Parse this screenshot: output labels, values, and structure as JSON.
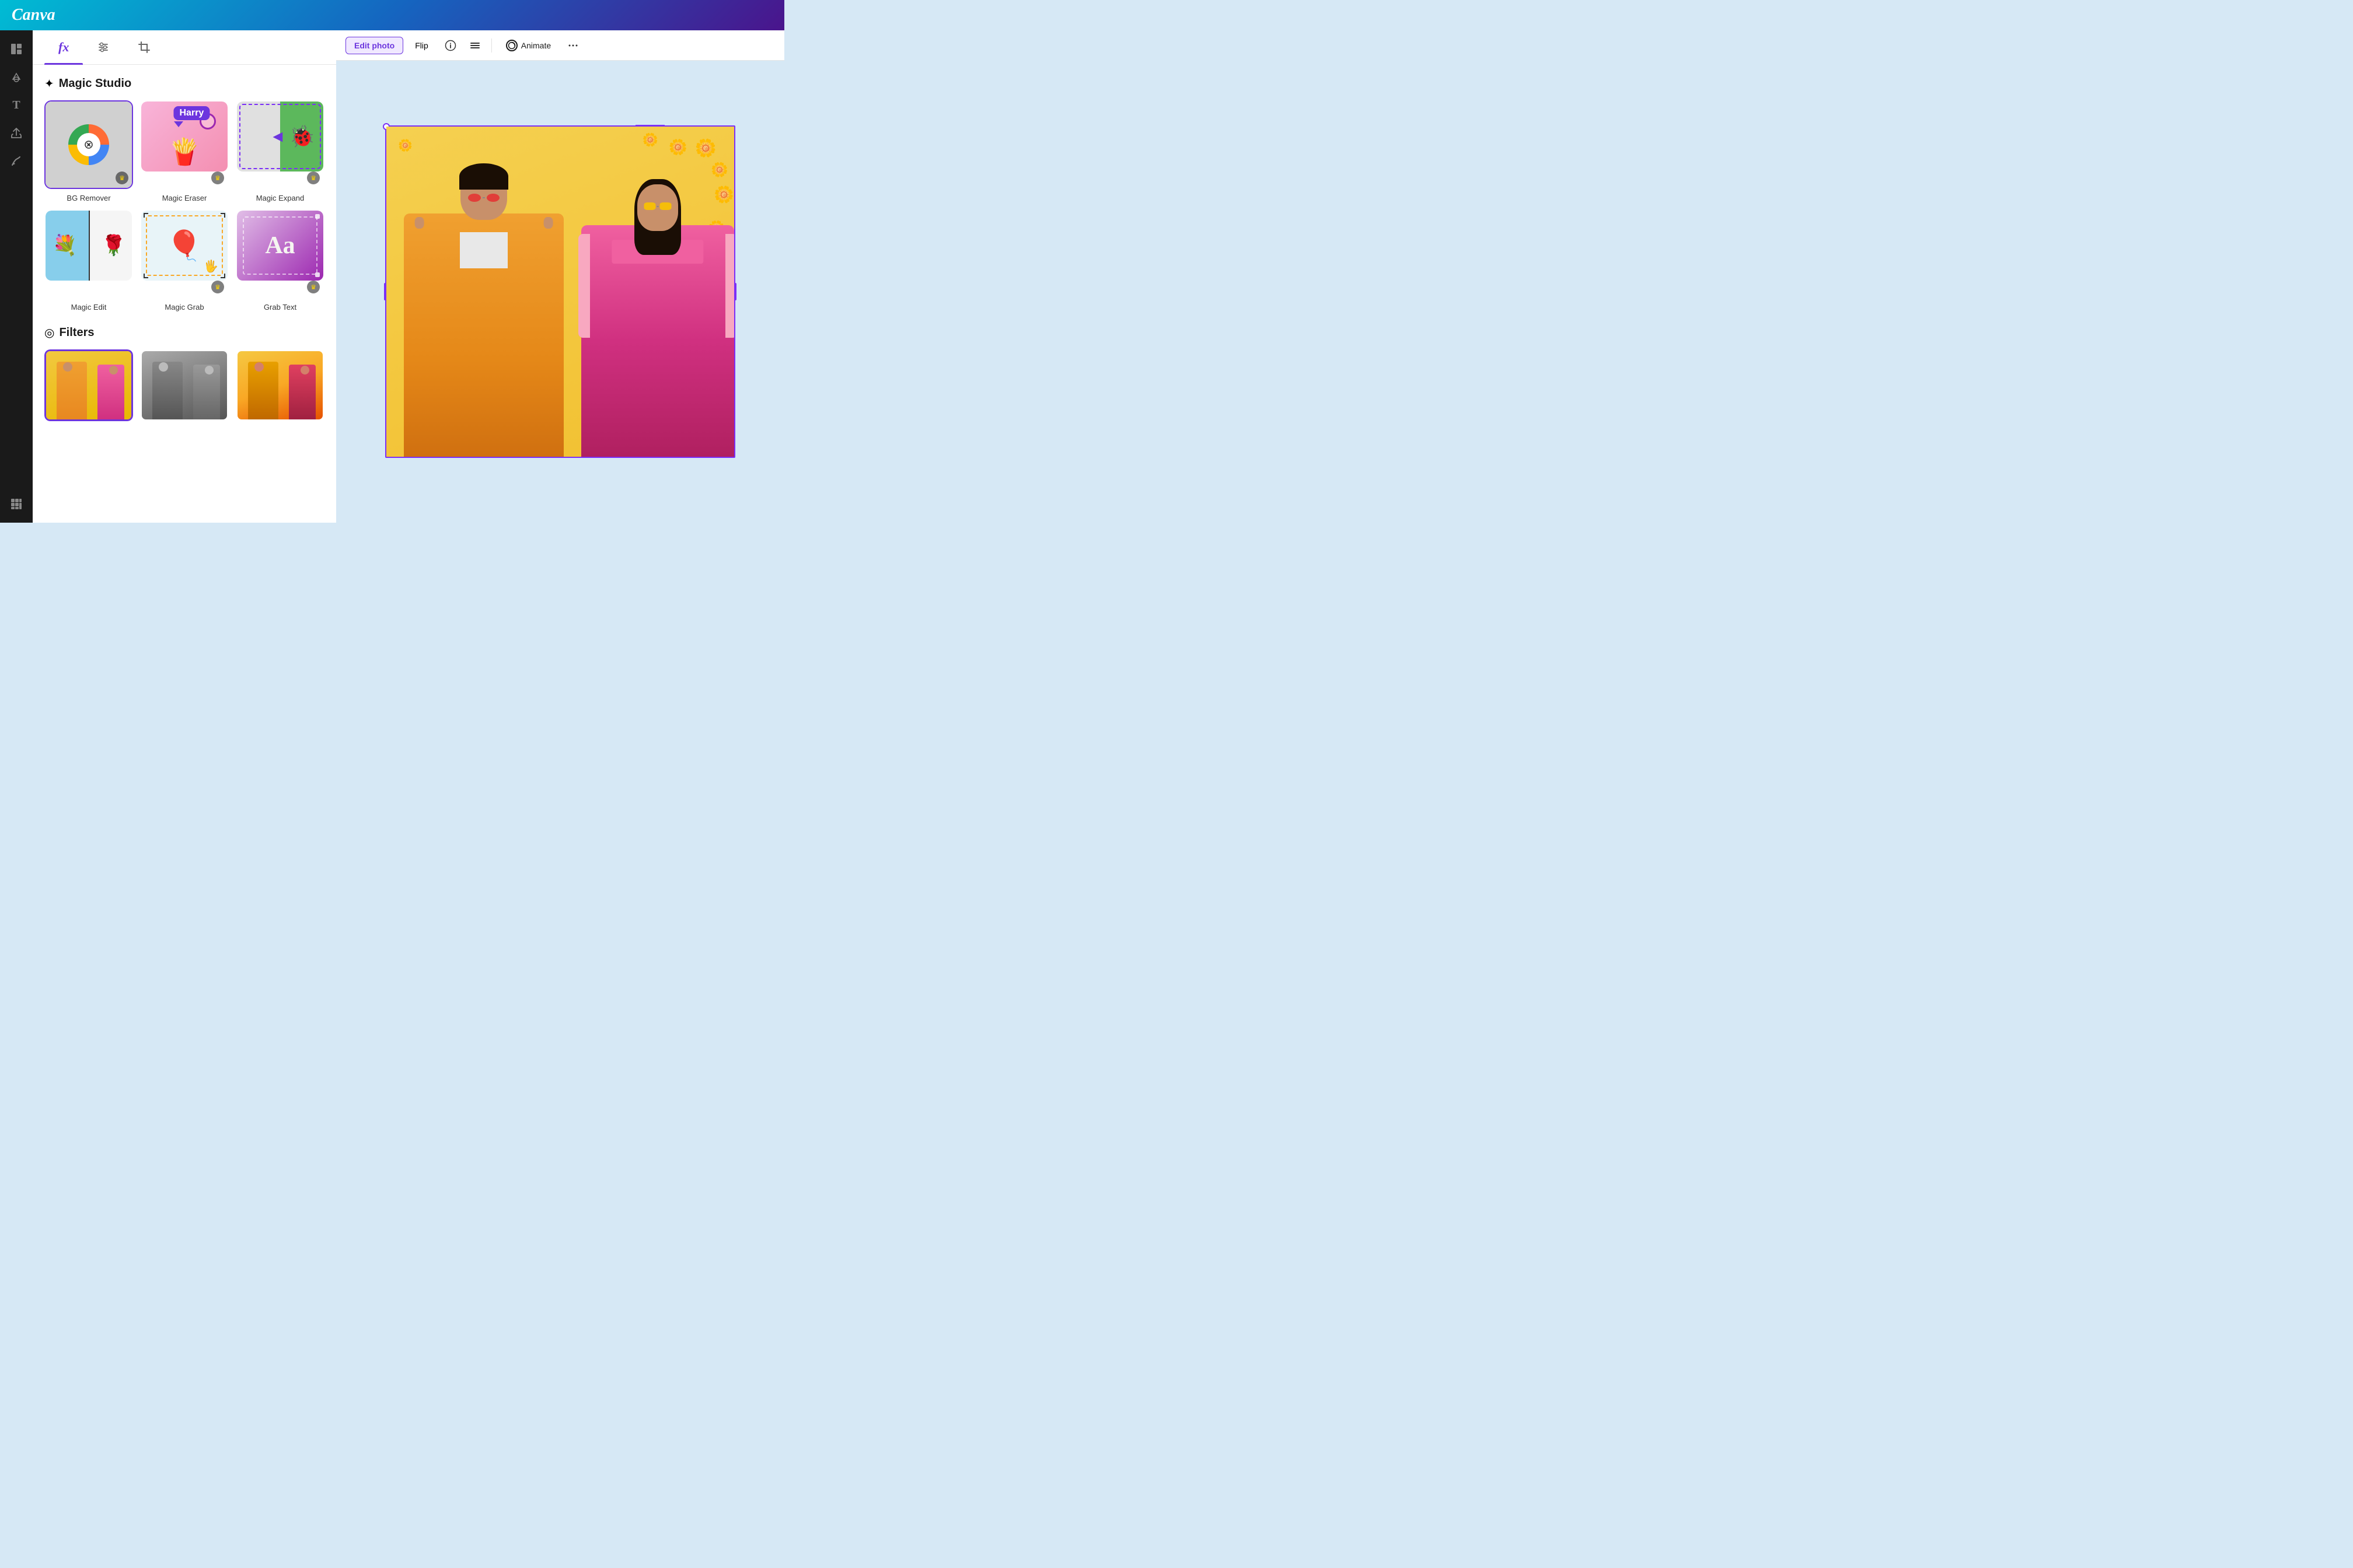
{
  "app": {
    "name": "Canva"
  },
  "header": {
    "logo": "Canva"
  },
  "sidebar": {
    "items": [
      {
        "id": "layout",
        "icon": "⊞",
        "label": "Layout"
      },
      {
        "id": "elements",
        "icon": "♡△",
        "label": "Elements"
      },
      {
        "id": "text",
        "icon": "T",
        "label": "Text"
      },
      {
        "id": "uploads",
        "icon": "↑",
        "label": "Uploads"
      },
      {
        "id": "draw",
        "icon": "✏",
        "label": "Draw"
      },
      {
        "id": "apps",
        "icon": "⋯",
        "label": "Apps"
      }
    ]
  },
  "panel": {
    "tabs": [
      {
        "id": "fx",
        "label": "fx",
        "icon": "fx",
        "active": true
      },
      {
        "id": "adjust",
        "label": "Adjust",
        "icon": "⊕"
      },
      {
        "id": "crop",
        "label": "Crop",
        "icon": "⊡"
      }
    ],
    "magic_studio": {
      "title": "Magic Studio",
      "tools": [
        {
          "id": "bg-remover",
          "label": "BG Remover",
          "has_crown": true,
          "selected": true
        },
        {
          "id": "magic-eraser",
          "label": "Magic Eraser",
          "has_crown": true
        },
        {
          "id": "magic-expand",
          "label": "Magic Expand",
          "has_crown": true
        },
        {
          "id": "magic-edit",
          "label": "Magic Edit",
          "has_crown": false
        },
        {
          "id": "magic-grab",
          "label": "Magic Grab",
          "has_crown": true
        },
        {
          "id": "grab-text",
          "label": "Grab Text",
          "has_crown": true
        }
      ]
    },
    "filters": {
      "title": "Filters",
      "items": [
        {
          "id": "original",
          "label": "",
          "selected": true
        },
        {
          "id": "bw",
          "label": ""
        },
        {
          "id": "warm",
          "label": ""
        }
      ]
    }
  },
  "toolbar": {
    "edit_photo_label": "Edit photo",
    "flip_label": "Flip",
    "info_label": "",
    "position_label": "",
    "animate_label": "Animate",
    "more_label": "..."
  },
  "canvas": {
    "photo_alt": "Two people in colorful outfits against yellow background with flowers"
  },
  "magic_eraser": {
    "bubble_text": "Harry"
  }
}
